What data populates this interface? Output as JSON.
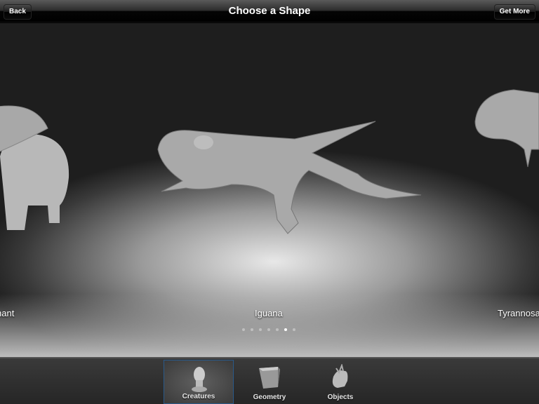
{
  "header": {
    "title": "Choose a Shape",
    "back_label": "Back",
    "get_more_label": "Get More"
  },
  "carousel": {
    "items": [
      {
        "label": "Elephant"
      },
      {
        "label": "Iguana"
      },
      {
        "label": "Tyrannosaurus"
      }
    ],
    "page_count": 7,
    "current_page": 6
  },
  "tabs": [
    {
      "label": "Creatures",
      "icon": "head-icon",
      "active": true
    },
    {
      "label": "Geometry",
      "icon": "cube-icon",
      "active": false
    },
    {
      "label": "Objects",
      "icon": "moose-head-icon",
      "active": false
    }
  ],
  "colors": {
    "selected_tab_border": "#2a5a8a"
  }
}
